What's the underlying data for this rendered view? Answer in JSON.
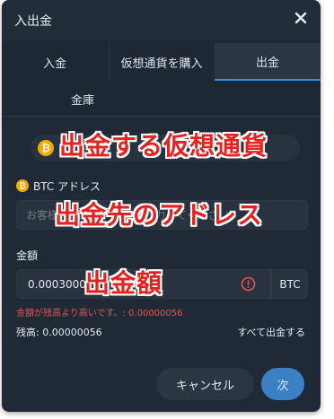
{
  "modal": {
    "title": "入出金"
  },
  "tabs": [
    {
      "label": "入金",
      "active": false
    },
    {
      "label": "仮想通貨を購入",
      "active": false
    },
    {
      "label": "出金",
      "active": true
    },
    {
      "label": "金庫",
      "active": false
    }
  ],
  "form": {
    "selected_crypto_icon": "bitcoin-icon",
    "address_label": "BTC アドレス",
    "address_placeholder": "お客様のBTCアドレスを入力してください",
    "amount_label": "金額",
    "amount_value": "0.0003000",
    "amount_unit": "BTC",
    "error_text": "金額が残高より高いです。: 0.00000056",
    "balance_text": "残高: 0.00000056",
    "withdraw_all_label": "すべて出金する"
  },
  "buttons": {
    "cancel_label": "キャンセル",
    "next_label": "次"
  },
  "annotations": {
    "crypto": "出金する仮想通貨",
    "address": "出金先のアドレス",
    "amount": "出金額"
  },
  "colors": {
    "modal_bg": "#1f2a36",
    "accent": "#3b8fd9",
    "next_button": "#3b7fc4",
    "error": "#e25555",
    "bitcoin": "#f2a900",
    "annotation": "#e42320"
  }
}
